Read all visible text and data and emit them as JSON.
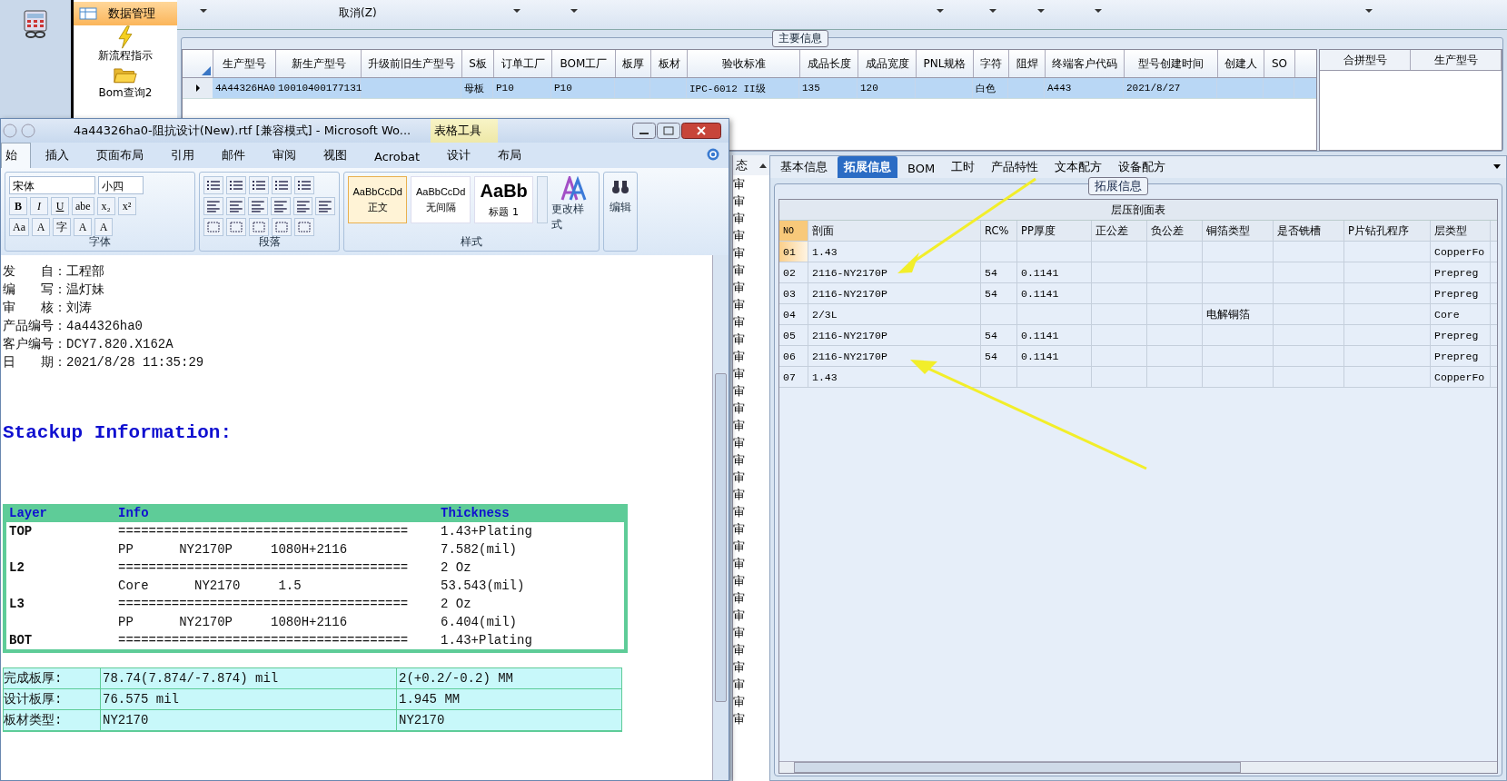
{
  "app": {
    "toolbar": {
      "items": [
        {
          "label": "取消(Z)"
        }
      ]
    },
    "sidebar": {
      "items": [
        {
          "label": "数据管理",
          "kind": "header",
          "selected": true
        },
        {
          "label": "新流程指示",
          "kind": "bolt",
          "selected": false
        },
        {
          "label": "Bom查询2",
          "kind": "folder",
          "selected": false
        }
      ]
    },
    "main_info": {
      "title": "主要信息",
      "columns": [
        "生产型号",
        "新生产型号",
        "升级前旧生产型号",
        "S板",
        "订单工厂",
        "BOM工厂",
        "板厚",
        "板材",
        "验收标准",
        "成品长度",
        "成品宽度",
        "PNL规格",
        "字符",
        "阻焊",
        "终端客户代码",
        "型号创建时间",
        "创建人",
        "SO"
      ],
      "rows": [
        {
          "selected": true,
          "cells": [
            "4A44326HA0",
            "10010400177131",
            "",
            "母板",
            "P10",
            "P10",
            "",
            "",
            "IPC-6012 II级",
            "135",
            "120",
            "",
            "白色",
            "",
            "A443",
            "2021/8/27",
            "",
            ""
          ]
        }
      ]
    },
    "merge_panel": {
      "columns": [
        "合拼型号",
        "生产型号"
      ]
    },
    "status_column": {
      "header": "态",
      "rows": [
        "审",
        "审",
        "审",
        "审",
        "审",
        "审",
        "审",
        "审",
        "审",
        "审",
        "审",
        "审",
        "审",
        "审",
        "审",
        "审",
        "审",
        "审",
        "审",
        "审",
        "审",
        "审",
        "审",
        "审",
        "审",
        "审",
        "审",
        "审",
        "审",
        "审",
        "审",
        "审"
      ]
    },
    "detail_panel": {
      "tabs": [
        {
          "label": "基本信息",
          "selected": false
        },
        {
          "label": "拓展信息",
          "selected": true
        },
        {
          "label": "BOM",
          "selected": false
        },
        {
          "label": "工时",
          "selected": false
        },
        {
          "label": "产品特性",
          "selected": false
        },
        {
          "label": "文本配方",
          "selected": false
        },
        {
          "label": "设备配方",
          "selected": false
        }
      ],
      "group_title": "拓展信息",
      "table": {
        "title": "层压剖面表",
        "columns": [
          "NO",
          "剖面",
          "RC%",
          "PP厚度",
          "正公差",
          "负公差",
          "铜箔类型",
          "是否铣槽",
          "P片钻孔程序",
          "层类型"
        ],
        "rows": [
          {
            "selected": true,
            "cells": [
              "01",
              "1.43",
              "",
              "",
              "",
              "",
              "",
              "",
              "",
              "CopperFo"
            ]
          },
          {
            "selected": false,
            "cells": [
              "02",
              "2116-NY2170P",
              "54",
              "0.1141",
              "",
              "",
              "",
              "",
              "",
              "Prepreg"
            ]
          },
          {
            "selected": false,
            "cells": [
              "03",
              "2116-NY2170P",
              "54",
              "0.1141",
              "",
              "",
              "",
              "",
              "",
              "Prepreg"
            ]
          },
          {
            "selected": false,
            "cells": [
              "04",
              "2/3L",
              "",
              "",
              "",
              "",
              "电解铜箔",
              "",
              "",
              "Core"
            ]
          },
          {
            "selected": false,
            "cells": [
              "05",
              "2116-NY2170P",
              "54",
              "0.1141",
              "",
              "",
              "",
              "",
              "",
              "Prepreg"
            ]
          },
          {
            "selected": false,
            "cells": [
              "06",
              "2116-NY2170P",
              "54",
              "0.1141",
              "",
              "",
              "",
              "",
              "",
              "Prepreg"
            ]
          },
          {
            "selected": false,
            "cells": [
              "07",
              "1.43",
              "",
              "",
              "",
              "",
              "",
              "",
              "",
              "CopperFo"
            ]
          }
        ]
      }
    }
  },
  "word": {
    "title": "4a44326ha0-阻抗设计(New).rtf [兼容模式] - Microsoft Wo...",
    "context_tab": "表格工具",
    "tabs": [
      {
        "label": "始",
        "selected": true
      },
      {
        "label": "插入",
        "selected": false
      },
      {
        "label": "页面布局",
        "selected": false
      },
      {
        "label": "引用",
        "selected": false
      },
      {
        "label": "邮件",
        "selected": false
      },
      {
        "label": "审阅",
        "selected": false
      },
      {
        "label": "视图",
        "selected": false
      },
      {
        "label": "Acrobat",
        "selected": false
      },
      {
        "label": "设计",
        "selected": false
      },
      {
        "label": "布局",
        "selected": false
      }
    ],
    "ribbon": {
      "font_name": "宋体",
      "font_size": "小四",
      "font_buttons": [
        "B",
        "I",
        "U",
        "abe",
        "x₂",
        "x²"
      ],
      "font_buttons_2": [
        "Aa",
        "A",
        "字",
        "A",
        "A"
      ],
      "styles": [
        {
          "sample": "AaBbCcDd",
          "name": "正文",
          "selected": true,
          "kind": "normal"
        },
        {
          "sample": "AaBbCcDd",
          "name": "无间隔",
          "selected": false,
          "kind": "normal"
        },
        {
          "sample": "AaBb",
          "name": "标题 1",
          "selected": false,
          "kind": "heading"
        }
      ],
      "change_styles": "更改样式",
      "edit": "编辑",
      "groups": [
        "字体",
        "段落",
        "样式"
      ]
    },
    "document": {
      "info_lines": [
        "发　　自：工程部",
        "编　　写：温灯妹",
        "审　　核：刘涛",
        "产品编号：4a44326ha0",
        "客户编号：DCY7.820.X162A",
        "日　　期：2021/8/28 11:35:29"
      ],
      "heading": "Stackup Information:",
      "stackup": {
        "columns": [
          "Layer",
          "Info",
          "Thickness"
        ],
        "rows": [
          [
            "TOP",
            "======================================",
            "1.43+Plating"
          ],
          [
            "",
            "PP      NY2170P     1080H+2116",
            "7.582(mil)"
          ],
          [
            "L2",
            "======================================",
            "2 Oz"
          ],
          [
            "",
            "Core      NY2170     1.5",
            "53.543(mil)"
          ],
          [
            "L3",
            "======================================",
            "2 Oz"
          ],
          [
            "",
            "PP      NY2170P     1080H+2116",
            "6.404(mil)"
          ],
          [
            "BOT",
            "======================================",
            "1.43+Plating"
          ]
        ]
      },
      "summary": [
        [
          "完成板厚:",
          "78.74(7.874/-7.874) mil",
          "2(+0.2/-0.2) MM"
        ],
        [
          "设计板厚:",
          "76.575 mil",
          "1.945 MM"
        ],
        [
          "板材类型:",
          "NY2170",
          "NY2170"
        ]
      ]
    }
  }
}
